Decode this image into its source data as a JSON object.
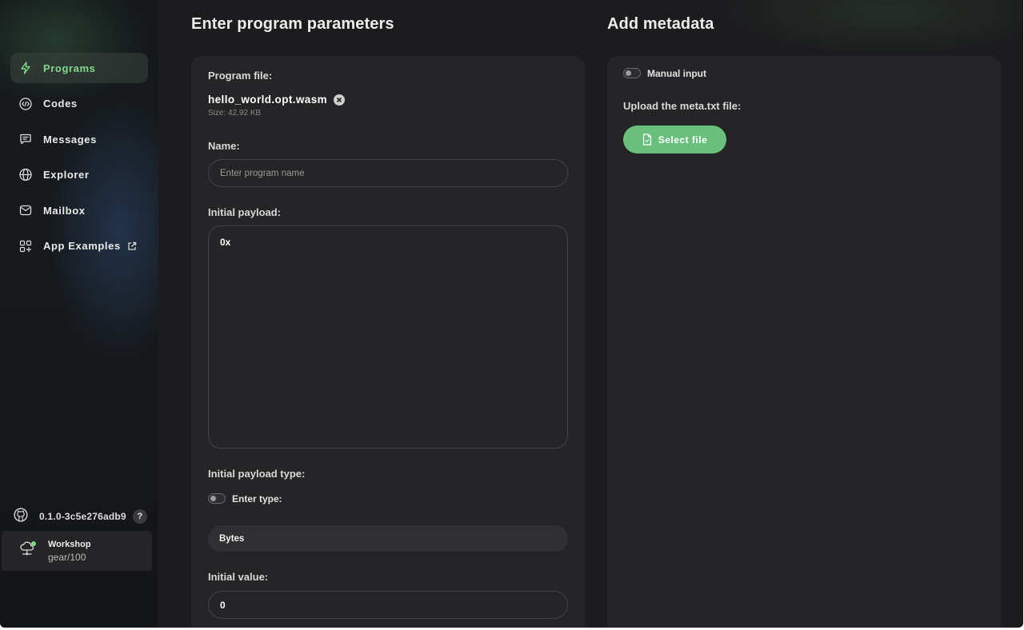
{
  "sidebar": {
    "items": [
      {
        "label": "Programs",
        "icon": "lightning-icon",
        "active": true
      },
      {
        "label": "Codes",
        "icon": "code-icon",
        "active": false
      },
      {
        "label": "Messages",
        "icon": "message-icon",
        "active": false
      },
      {
        "label": "Explorer",
        "icon": "globe-icon",
        "active": false
      },
      {
        "label": "Mailbox",
        "icon": "mail-icon",
        "active": false
      },
      {
        "label": "App Examples",
        "icon": "apps-icon",
        "active": false,
        "external": true
      }
    ],
    "version": "0.1.0-3c5e276adb9",
    "help": "?",
    "node": {
      "name": "Workshop",
      "address": "gear/100",
      "status_color": "#7fd98b"
    }
  },
  "program": {
    "heading": "Enter program parameters",
    "file_label": "Program file:",
    "file_name": "hello_world.opt.wasm",
    "file_size": "Size: 42.92 KB",
    "name_label": "Name:",
    "name_placeholder": "Enter program name",
    "payload_label": "Initial payload:",
    "payload_value": "0x",
    "payload_type_label": "Initial payload type:",
    "enter_type_label": "Enter type:",
    "payload_type_value": "Bytes",
    "value_label": "Initial value:",
    "value": "0"
  },
  "metadata": {
    "heading": "Add metadata",
    "manual_input_label": "Manual input",
    "upload_label": "Upload the meta.txt file:",
    "select_file_label": "Select file"
  },
  "colors": {
    "accent": "#68c07c",
    "active_nav": "#7fd98b",
    "background": "#1c1c1e",
    "card": "#252527"
  }
}
